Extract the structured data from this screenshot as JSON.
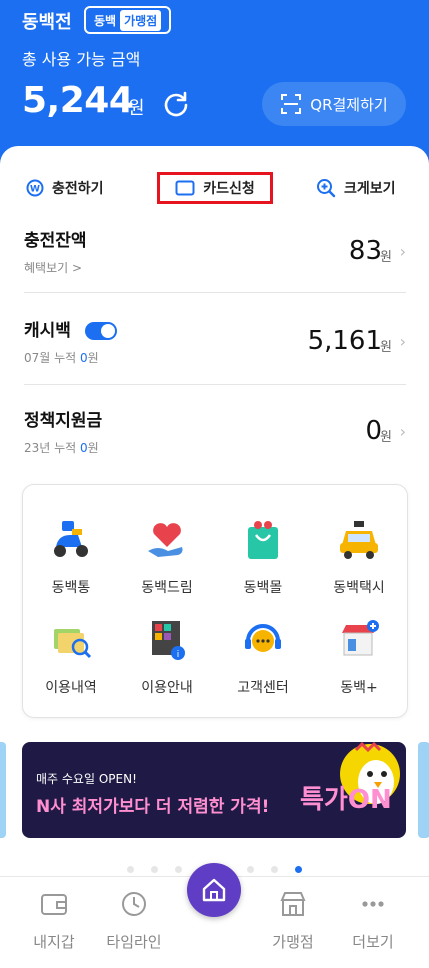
{
  "header": {
    "logo": "동백전",
    "badge_left": "동백",
    "badge_right": "가맹점",
    "subtitle": "총 사용 가능 금액",
    "amount": "5,244",
    "amount_unit": "원",
    "qr_button": "QR결제하기"
  },
  "actions": {
    "charge": "충전하기",
    "card_apply": "카드신청",
    "zoom": "크게보기"
  },
  "balances": [
    {
      "title": "충전잔액",
      "sub": "혜택보기 >",
      "value": "83",
      "unit": "원"
    },
    {
      "title": "캐시백",
      "sub_prefix": "07월 누적 ",
      "sub_value": "0",
      "sub_suffix": "원",
      "value": "5,161",
      "unit": "원",
      "toggle_on": true
    },
    {
      "title": "정책지원금",
      "sub_prefix": "23년 누적 ",
      "sub_value": "0",
      "sub_suffix": "원",
      "value": "0",
      "unit": "원"
    }
  ],
  "menu": [
    {
      "label": "동백통",
      "icon": "scooter-icon"
    },
    {
      "label": "동백드림",
      "icon": "heart-hand-icon"
    },
    {
      "label": "동백몰",
      "icon": "shopping-bag-icon"
    },
    {
      "label": "동백택시",
      "icon": "taxi-icon"
    },
    {
      "label": "이용내역",
      "icon": "history-search-icon"
    },
    {
      "label": "이용안내",
      "icon": "guide-icon"
    },
    {
      "label": "고객센터",
      "icon": "headset-icon"
    },
    {
      "label": "동백+",
      "icon": "store-plus-icon"
    }
  ],
  "banner": {
    "small": "매주 수요일 OPEN!",
    "big": "N사 최저가보다 더 저렴한 가격!",
    "logo": "특가ON"
  },
  "carousel": {
    "count": 8,
    "active": 7
  },
  "bottom_nav": [
    {
      "label": "내지갑",
      "icon": "wallet-icon"
    },
    {
      "label": "타임라인",
      "icon": "clock-icon"
    },
    {
      "label": "",
      "icon": "home-icon"
    },
    {
      "label": "가맹점",
      "icon": "store-icon"
    },
    {
      "label": "더보기",
      "icon": "more-icon"
    }
  ],
  "colors": {
    "primary": "#1b6ff0",
    "highlight": "#e5141e",
    "home": "#5f3dc4"
  }
}
